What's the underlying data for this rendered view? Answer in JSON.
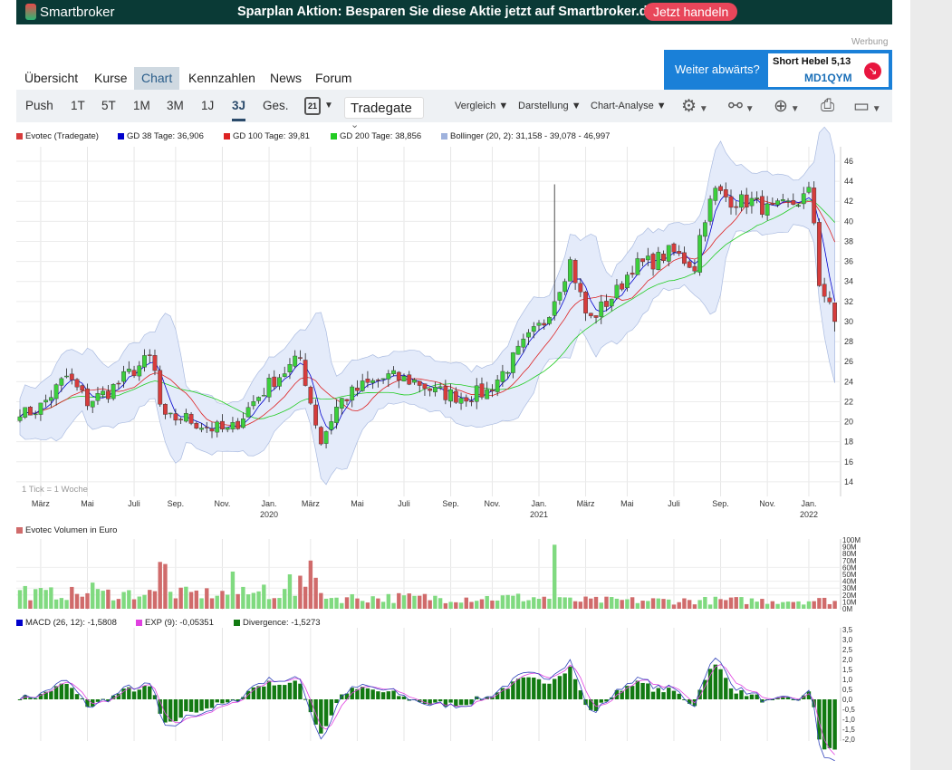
{
  "banner": {
    "brand": "Smartbroker",
    "promo": "Sparplan Aktion: Besparen Sie diese Aktie jetzt auf Smartbroker.de",
    "cta": "Jetzt handeln"
  },
  "ad": {
    "label": "Werbung",
    "question": "Weiter abwärts?",
    "product": "Short Hebel 5,13",
    "code": "MD1QYM"
  },
  "tabs": [
    "Übersicht",
    "Kurse",
    "Chart",
    "Kennzahlen",
    "News",
    "Forum"
  ],
  "toolbar": {
    "ranges": [
      "Push",
      "1T",
      "5T",
      "1M",
      "3M",
      "1J",
      "3J",
      "Ges."
    ],
    "active_range": "3J",
    "calendar_day": "21",
    "exchange": "Tradegate",
    "menus": [
      "Vergleich",
      "Darstellung",
      "Chart-Analyse"
    ],
    "icons": [
      "gear-icon",
      "nodes-icon",
      "zoom-in-icon",
      "print-icon",
      "save-icon"
    ]
  },
  "colors": {
    "up": "#3ccf3c",
    "down": "#d63c3c",
    "gd38": "#0000cc",
    "gd100": "#dd2222",
    "gd200": "#22cc22",
    "bollinger": "#9fb2dd",
    "vol_up": "#80da80",
    "vol_down": "#d06b6b",
    "divergence": "#127a12",
    "exp": "#e040e0"
  },
  "chart_data": [
    {
      "type": "candlestick",
      "title": "Evotec (Tradegate)",
      "interval_note": "1 Tick = 1 Woche",
      "legend": [
        "Evotec (Tradegate)",
        "GD 38 Tage: 36,906",
        "GD 100 Tage: 39,81",
        "GD 200 Tage: 38,856",
        "Bollinger (20, 2): 31,158 - 39,078 - 46,997"
      ],
      "ylim": [
        13,
        47
      ],
      "yticks": [
        14,
        16,
        18,
        20,
        22,
        24,
        26,
        28,
        30,
        32,
        34,
        36,
        38,
        40,
        42,
        44,
        46
      ],
      "xticks": [
        "März",
        "Mai",
        "Juli",
        "Sep.",
        "Nov.",
        "Jan.",
        "März",
        "Mai",
        "Juli",
        "Sep.",
        "Nov.",
        "Jan.",
        "März",
        "Mai",
        "Juli",
        "Sep.",
        "Nov.",
        "Jan."
      ],
      "xtick_weeks": [
        4,
        13,
        22,
        30,
        39,
        48,
        56,
        65,
        74,
        83,
        91,
        100,
        109,
        117,
        126,
        135,
        144,
        152
      ],
      "years": [
        {
          "label": "2020",
          "week": 48
        },
        {
          "label": "2021",
          "week": 100
        },
        {
          "label": "2022",
          "week": 152
        }
      ],
      "weeks": 158,
      "weekly_close_keypoints": [
        [
          0,
          20.5
        ],
        [
          4,
          21.5
        ],
        [
          9,
          24.5
        ],
        [
          13,
          22
        ],
        [
          17,
          23
        ],
        [
          21.5,
          25
        ],
        [
          25.5,
          26.5
        ],
        [
          27.5,
          20
        ],
        [
          31,
          20.5
        ],
        [
          36,
          19.5
        ],
        [
          40.5,
          19
        ],
        [
          45,
          22
        ],
        [
          48.5,
          24
        ],
        [
          54,
          26.3
        ],
        [
          56,
          22
        ],
        [
          58,
          18
        ],
        [
          61.5,
          22
        ],
        [
          66,
          23.5
        ],
        [
          71,
          24.5
        ],
        [
          76.5,
          24
        ],
        [
          80,
          23
        ],
        [
          85,
          22.5
        ],
        [
          90,
          23
        ],
        [
          94,
          25.5
        ],
        [
          97.5,
          28
        ],
        [
          101,
          30
        ],
        [
          103.5,
          33
        ],
        [
          106,
          36
        ],
        [
          109.5,
          30
        ],
        [
          115,
          33
        ],
        [
          118,
          35.5
        ],
        [
          122,
          36
        ],
        [
          125.5,
          37
        ],
        [
          130,
          35.5
        ],
        [
          131.5,
          40
        ],
        [
          134,
          43
        ],
        [
          137.5,
          42
        ],
        [
          141,
          42
        ],
        [
          144.5,
          41
        ],
        [
          150,
          42
        ],
        [
          152.5,
          43
        ],
        [
          154,
          34
        ],
        [
          157,
          30
        ]
      ]
    },
    {
      "type": "bar",
      "title": "Evotec Volumen in Euro",
      "ylim": [
        0,
        100
      ],
      "yticks": [
        "0M",
        "10M",
        "20M",
        "30M",
        "40M",
        "50M",
        "60M",
        "70M",
        "80M",
        "90M",
        "100M"
      ],
      "volume_spikes_M": [
        [
          1,
          33
        ],
        [
          14,
          38
        ],
        [
          27,
          68
        ],
        [
          28,
          65
        ],
        [
          41,
          54
        ],
        [
          47,
          35
        ],
        [
          52,
          50
        ],
        [
          54,
          48
        ],
        [
          56,
          70
        ],
        [
          57,
          45
        ],
        [
          103,
          93
        ]
      ]
    },
    {
      "type": "line",
      "title": "MACD",
      "legend": [
        "MACD (26, 12): -1,5808",
        "EXP (9): -0,05351",
        "Divergence: -1,5273"
      ],
      "ylim": [
        -2,
        3.5
      ],
      "yticks": [
        "3,5",
        "3,0",
        "2,5",
        "2,0",
        "1,5",
        "1,0",
        "0,5",
        "0,0",
        "-0,5",
        "-1,0",
        "-1,5",
        "-2,0"
      ]
    }
  ]
}
